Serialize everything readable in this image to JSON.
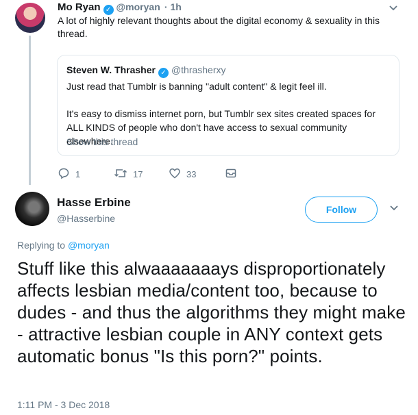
{
  "parent_tweet": {
    "author_name": "Mo Ryan",
    "author_handle": "@moryan",
    "time_ago": "· 1h",
    "text": "A lot of highly relevant thoughts about the digital economy & sexuality in this thread.",
    "quoted": {
      "author_name": "Steven W. Thrasher",
      "author_handle": "@thrasherxy",
      "paragraph1": "Just read that Tumblr is banning \"adult content\" & legit feel ill.",
      "paragraph2": "It's easy to dismiss internet porn, but Tumblr sex sites created spaces for ALL KINDS of people who don't have access to sexual community elsewhere.",
      "show_thread": "Show this thread"
    },
    "actions": {
      "reply_count": "1",
      "retweet_count": "17",
      "like_count": "33"
    }
  },
  "main_tweet": {
    "author_name": "Hasse Erbine",
    "author_handle": "@Hasserbine",
    "follow_label": "Follow",
    "replying_prefix": "Replying to",
    "replying_to": "@moryan",
    "text": "Stuff like this alwaaaaaaays disproportionately affects lesbian media/content too, because to dudes - and thus the algorithms they might make - attractive lesbian couple in ANY context gets automatic bonus \"Is this porn?\" points.",
    "timestamp": "1:11 PM - 3 Dec 2018"
  },
  "colors": {
    "accent": "#1da1f2",
    "secondary_text": "#657786",
    "border": "#e1e8ed"
  },
  "icons": [
    "verified-icon",
    "chevron-down-icon",
    "reply-icon",
    "retweet-icon",
    "like-icon",
    "message-icon"
  ]
}
